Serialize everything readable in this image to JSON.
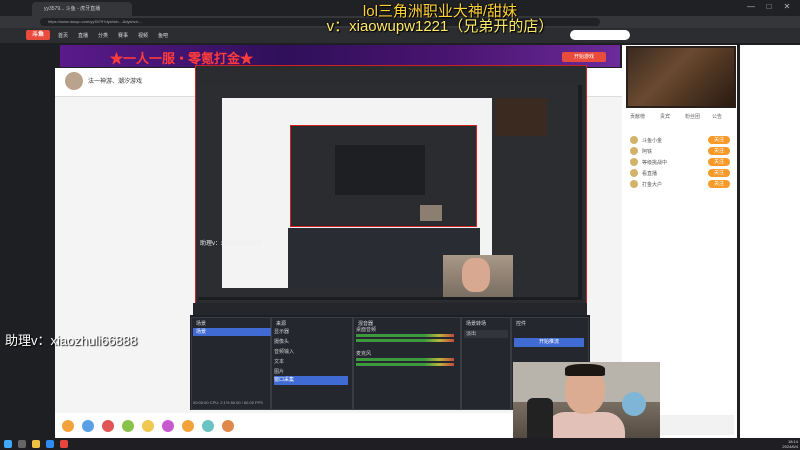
{
  "browser": {
    "tab_title": "yy3579... 斗鱼 - 虎牙直播",
    "url": "https://www.douyu.com/yy3579?dyshid=...&dyshci=...",
    "window_buttons": [
      "—",
      "□",
      "✕"
    ]
  },
  "site": {
    "logo_text": "斗鱼",
    "nav": [
      "首页",
      "直播",
      "分类",
      "赛事",
      "视频",
      "鱼吧"
    ],
    "banner_text": "★一人一服・零氪打金★",
    "banner_button": "开始游戏",
    "streamer_name": "法一神游、潮汐游戏"
  },
  "overlay": {
    "line1": "lol三角洲职业大神/甜妹",
    "line2": "v：xiaowupw1221（兄弟开的店）",
    "assistant": "助理v：xiaozhuli66888"
  },
  "nested_watermark": "助理v：xiaozhuli66888",
  "side": {
    "tabs": [
      "贡献榜",
      "贵宾",
      "粉丝团",
      "公告"
    ],
    "ranks": [
      {
        "name": "斗鱼小金",
        "btn": "关注"
      },
      {
        "name": "阿铁",
        "btn": "关注"
      },
      {
        "name": "等级挑战中",
        "btn": "关注"
      },
      {
        "name": "看直播",
        "btn": "关注"
      },
      {
        "name": "打金大户",
        "btn": "关注"
      }
    ]
  },
  "obs": {
    "panels": [
      "场景",
      "来源",
      "混音器",
      "场景转场",
      "控件"
    ],
    "scene": "场景",
    "sources": [
      "显示器",
      "摄像头",
      "音频输入",
      "文本",
      "图片",
      "窗口采集"
    ],
    "mixer": [
      "桌面音频",
      "麦克风"
    ],
    "transition": "淡出",
    "control": "开始推流",
    "status": "00:00:00  CPU: 2.1%  60.00 / 60.00 FPS"
  },
  "taskbar": {
    "time": "18:14",
    "date": "2024/6/4"
  },
  "colors": {
    "accent": "#3f6bd3",
    "capture_border": "#cc2222",
    "overlay_text": "#ffd23a",
    "brand": "#e94b3c"
  }
}
